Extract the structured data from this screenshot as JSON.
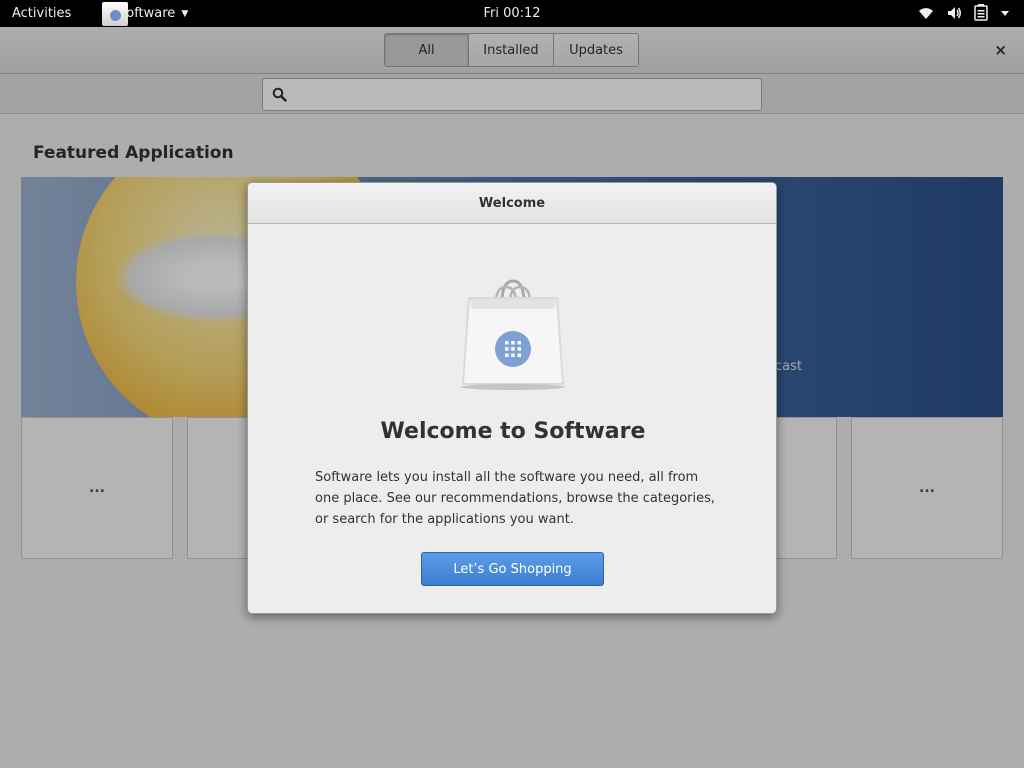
{
  "top_bar": {
    "activities": "Activities",
    "app_name": "Software",
    "clock": "Fri 00:12"
  },
  "header": {
    "tabs": [
      {
        "label": "All",
        "active": true
      },
      {
        "label": "Installed",
        "active": false
      },
      {
        "label": "Updates",
        "active": false
      }
    ],
    "close_icon": "×"
  },
  "search": {
    "placeholder": "",
    "value": ""
  },
  "main": {
    "featured_title": "Featured Application",
    "banner_caption": "cast",
    "tiles": [
      "...",
      "...",
      "...",
      "..."
    ]
  },
  "dialog": {
    "title": "Welcome",
    "heading": "Welcome to Software",
    "body": "Software lets you install all the software you need, all from one place. See our recommendations, browse the categories, or search for the applications you want.",
    "button": "Let’s Go Shopping"
  },
  "colors": {
    "accent": "#3b7dd1",
    "top_bar": "#000000"
  }
}
